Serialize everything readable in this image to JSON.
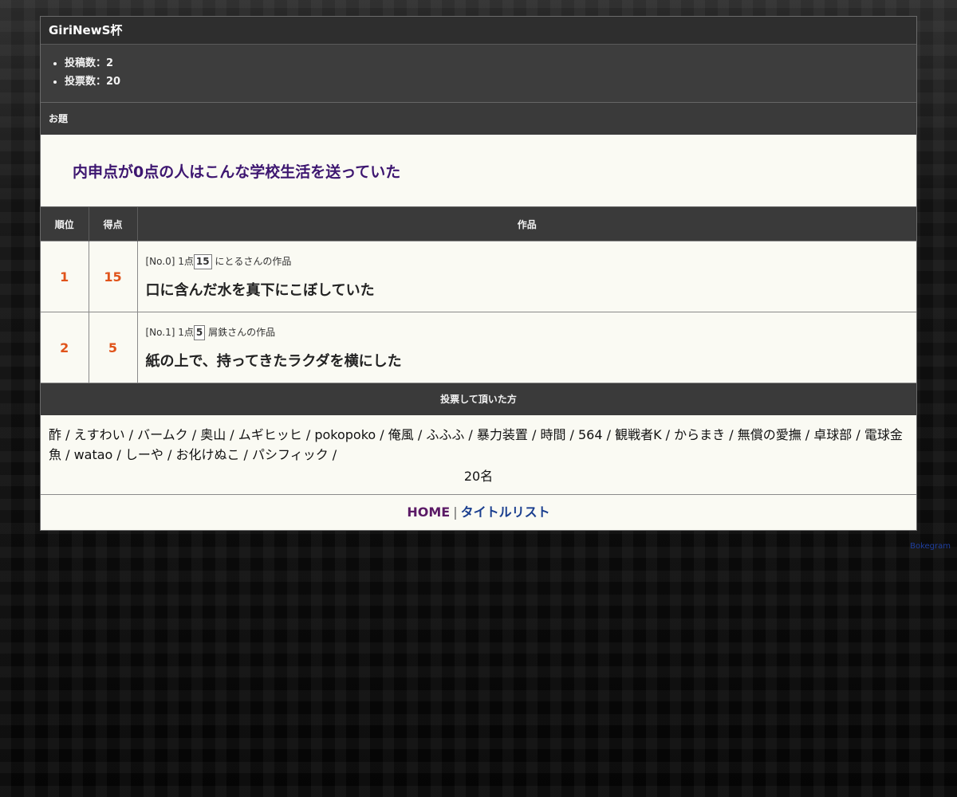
{
  "contest": {
    "title": "GiriNewS杯",
    "stats": [
      "投稿数：2",
      "投票数：20"
    ]
  },
  "odai": {
    "heading": "お題",
    "text": "内申点が0点の人はこんな学校生活を送っていた"
  },
  "results": {
    "headers": {
      "rank": "順位",
      "score": "得点",
      "work": "作品"
    },
    "rows": [
      {
        "rank": "1",
        "score": "15",
        "meta_prefix": "[No.0] 1点",
        "meta_points": "15",
        "meta_author": "にとるさんの作品",
        "text": "口に含んだ水を真下にこぼしていた"
      },
      {
        "rank": "2",
        "score": "5",
        "meta_prefix": "[No.1] 1点",
        "meta_points": "5",
        "meta_author": "屑鉄さんの作品",
        "text": "紙の上で、持ってきたラクダを横にした"
      }
    ]
  },
  "voters": {
    "heading": "投票して頂いた方",
    "names": "酢 / えすわい / バームク / 奥山 / ムギヒッヒ / pokopoko / 俺風 / ふふふ / 暴力装置 / 時間 / 564 / 観戦者K / からまき / 無償の愛撫 / 卓球部 / 電球金魚 / watao / しーや / お化けぬこ / パシフィック /",
    "count": "20名"
  },
  "nav": {
    "home": "HOME",
    "separator": "|",
    "title_list": "タイトルリスト"
  },
  "credit": "Bokegram"
}
